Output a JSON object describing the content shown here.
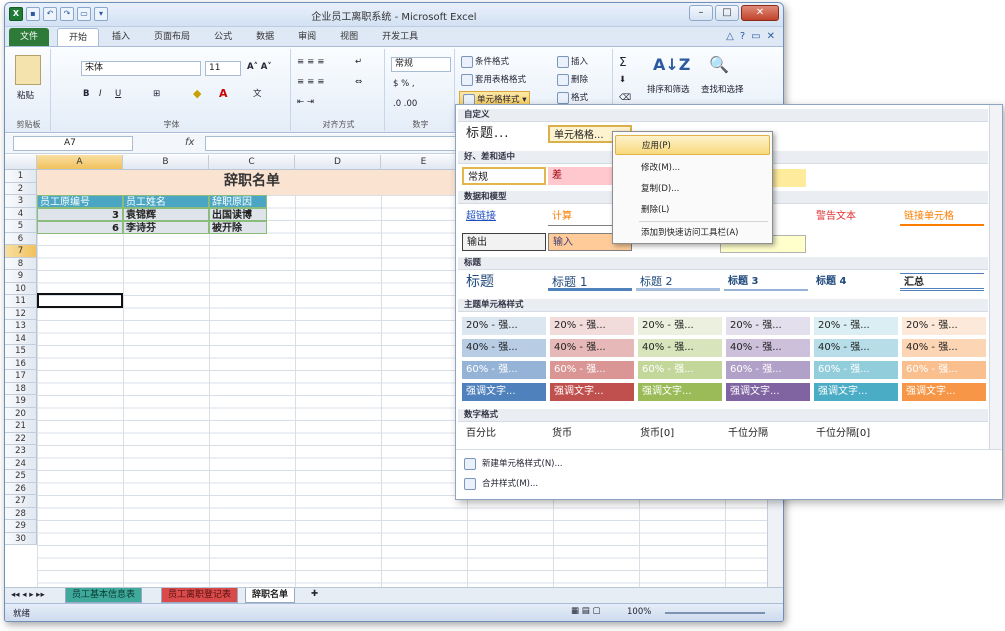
{
  "window": {
    "title": "企业员工离职系统 - Microsoft Excel"
  },
  "tabs": [
    "文件",
    "开始",
    "插入",
    "页面布局",
    "公式",
    "数据",
    "审阅",
    "视图",
    "开发工具"
  ],
  "ribbon": {
    "font_name": "宋体",
    "font_size": "11",
    "number_format": "常规",
    "paste_label": "粘贴",
    "cond_format": "条件格式",
    "table_format": "套用表格格式",
    "cell_styles": "单元格样式",
    "insert": "插入",
    "delete": "删除",
    "format": "格式",
    "sort_filter": "排序和筛选",
    "find_select": "查找和选择",
    "groups": [
      "剪贴板",
      "字体",
      "对齐方式",
      "数字"
    ]
  },
  "formula_bar": {
    "name_box": "A7",
    "fx": "fx",
    "content": ""
  },
  "columns": [
    "A",
    "B",
    "C",
    "D",
    "E",
    "F"
  ],
  "rows": [
    "1",
    "2",
    "3",
    "4",
    "5",
    "6",
    "7",
    "8",
    "9",
    "10",
    "11",
    "12",
    "13",
    "14",
    "15",
    "16",
    "17",
    "18",
    "19",
    "20",
    "21",
    "22",
    "23",
    "24",
    "25",
    "26",
    "27",
    "28",
    "29",
    "30"
  ],
  "sheet": {
    "title": "辞职名单",
    "headers": [
      "员工原编号",
      "员工姓名",
      "辞职原因"
    ],
    "rows": [
      {
        "id": "3",
        "name": "袁锦辉",
        "reason": "出国读博"
      },
      {
        "id": "6",
        "name": "李诗芬",
        "reason": "被开除"
      }
    ]
  },
  "sheet_tabs": [
    "员工基本信息表",
    "员工离职登记表",
    "辞职名单"
  ],
  "status": {
    "ready": "就绪",
    "zoom": "100%"
  },
  "gallery": {
    "custom_header": "自定义",
    "custom_items": [
      "标题...",
      "单元格格..."
    ],
    "goodbad_header": "好、差和适中",
    "goodbad_items": [
      "常规",
      "差"
    ],
    "data_model_header": "数据和模型",
    "data_model_items": [
      "超链接",
      "计算",
      "输出",
      "输入",
      "警告文本",
      "链接单元格"
    ],
    "title_header": "标题",
    "title_items": [
      "标题",
      "标题 1",
      "标题 2",
      "标题 3",
      "标题 4",
      "汇总"
    ],
    "theme_header": "主题单元格样式",
    "theme_row20": [
      "20% - 强...",
      "20% - 强...",
      "20% - 强...",
      "20% - 强...",
      "20% - 强...",
      "20% - 强..."
    ],
    "theme_row40": [
      "40% - 强...",
      "40% - 强...",
      "40% - 强...",
      "40% - 强...",
      "40% - 强...",
      "40% - 强..."
    ],
    "theme_row60": [
      "60% - 强...",
      "60% - 强...",
      "60% - 强...",
      "60% - 强...",
      "60% - 强...",
      "60% - 强..."
    ],
    "theme_accent": [
      "强调文字...",
      "强调文字...",
      "强调文字...",
      "强调文字...",
      "强调文字...",
      "强调文字..."
    ],
    "number_header": "数字格式",
    "number_items": [
      "百分比",
      "货币",
      "货币[0]",
      "千位分隔",
      "千位分隔[0]"
    ],
    "new_style": "新建单元格样式(N)...",
    "merge_style": "合并样式(M)..."
  },
  "context_menu": [
    "应用(P)",
    "修改(M)...",
    "复制(D)...",
    "删除(L)",
    "添加到快速访问工具栏(A)"
  ]
}
